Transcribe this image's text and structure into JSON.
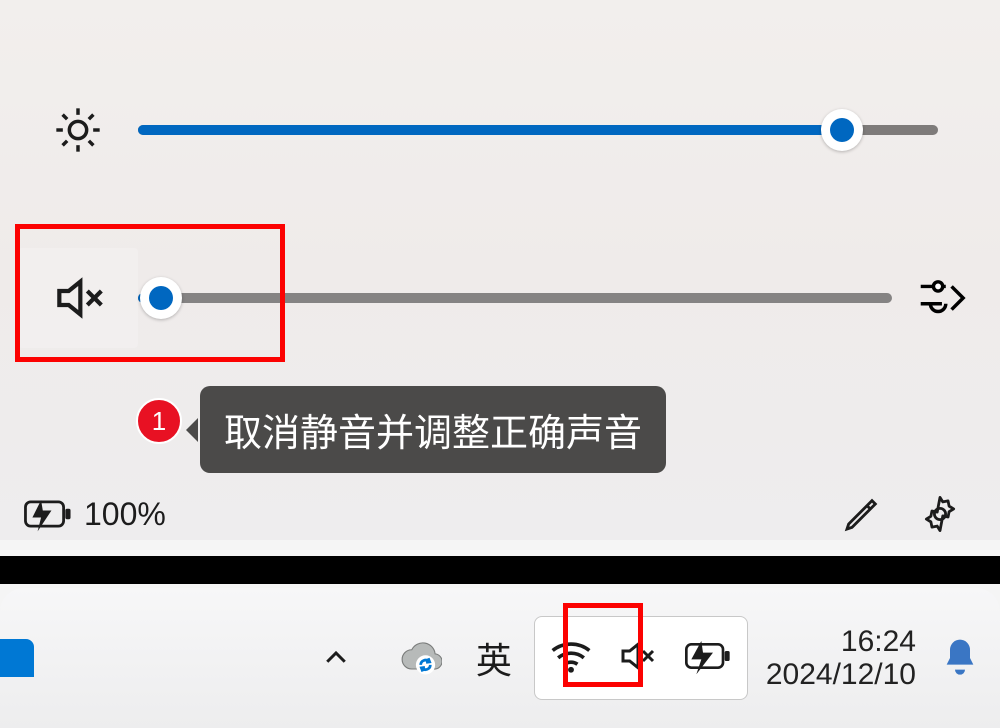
{
  "quick_settings": {
    "brightness": {
      "value_percent": 88
    },
    "volume": {
      "muted": true,
      "value_percent": 3
    },
    "battery_percent": "100%"
  },
  "annotation": {
    "step_number": "1",
    "tooltip_text": "取消静音并调整正确声音"
  },
  "taskbar": {
    "ime_label": "英",
    "time": "16:24",
    "date": "2024/12/10"
  },
  "colors": {
    "accent": "#0067c0",
    "highlight": "#fc0201",
    "tooltip_bg": "#4b4a49",
    "badge_bg": "#e81123"
  }
}
